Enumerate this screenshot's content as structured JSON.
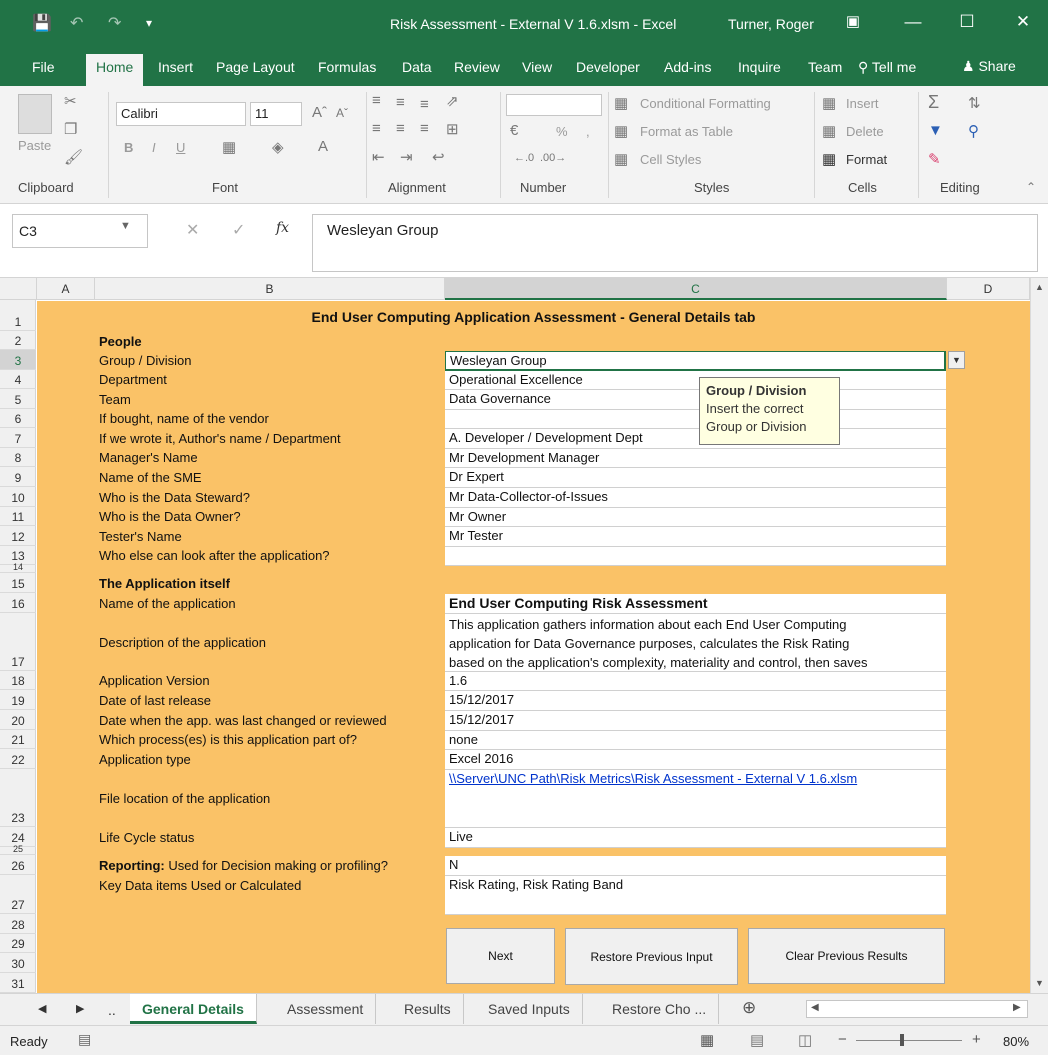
{
  "window": {
    "title": "Risk Assessment - External V 1.6.xlsm - Excel",
    "user": "Turner, Roger"
  },
  "ribbon_tabs": [
    "File",
    "Home",
    "Insert",
    "Page Layout",
    "Formulas",
    "Data",
    "Review",
    "View",
    "Developer",
    "Add-ins",
    "Inquire",
    "Team"
  ],
  "tell_me": "Tell me",
  "share": "Share",
  "ribbon": {
    "clipboard": {
      "label": "Clipboard",
      "paste": "Paste"
    },
    "font": {
      "label": "Font",
      "name": "Calibri",
      "size": "11",
      "bold": "B",
      "italic": "I",
      "underline": "U"
    },
    "alignment": {
      "label": "Alignment"
    },
    "number": {
      "label": "Number",
      "percent": "%",
      "comma": ","
    },
    "styles": {
      "label": "Styles",
      "conditional": "Conditional Formatting",
      "table": "Format as Table",
      "cell_styles": "Cell Styles"
    },
    "cells": {
      "label": "Cells",
      "insert": "Insert",
      "delete": "Delete",
      "format": "Format"
    },
    "editing": {
      "label": "Editing"
    }
  },
  "formula_bar": {
    "name_box": "C3",
    "fx": "fx",
    "content": "Wesleyan Group"
  },
  "columns": [
    "A",
    "B",
    "C",
    "D"
  ],
  "rows": [
    "1",
    "2",
    "3",
    "4",
    "5",
    "6",
    "7",
    "8",
    "9",
    "10",
    "11",
    "12",
    "13",
    "14",
    "15",
    "16",
    "17",
    "18",
    "19",
    "20",
    "21",
    "22",
    "23",
    "24",
    "25",
    "26",
    "27",
    "28",
    "29",
    "30",
    "31"
  ],
  "sheet": {
    "title": "End User Computing Application Assessment - General Details tab",
    "people_header": "People",
    "app_header": "The Application itself",
    "reporting_prefix": "Reporting:",
    "reporting_label": " Used for Decision making or profiling?",
    "reporting_value": "N",
    "key_data_label": "Key Data items Used or Calculated",
    "key_data_value": "Risk Rating, Risk Rating Band",
    "people": [
      {
        "label": "Group / Division",
        "value": "Wesleyan Group"
      },
      {
        "label": "Department",
        "value": "Operational Excellence"
      },
      {
        "label": "Team",
        "value": "Data Governance"
      },
      {
        "label": "If bought, name of the vendor",
        "value": ""
      },
      {
        "label": "If we wrote it, Author's name / Department",
        "value": "A. Developer / Development Dept"
      },
      {
        "label": "Manager's Name",
        "value": "Mr Development Manager"
      },
      {
        "label": "Name of the SME",
        "value": "Dr Expert"
      },
      {
        "label": "Who is the Data Steward?",
        "value": "Mr Data-Collector-of-Issues"
      },
      {
        "label": "Who is the Data Owner?",
        "value": "Mr Owner"
      },
      {
        "label": "Tester's Name",
        "value": "Mr Tester"
      },
      {
        "label": "Who else can look after the application?",
        "value": ""
      }
    ],
    "app": {
      "name_label": "Name of the application",
      "name_value": "End User Computing Risk Assessment",
      "desc_label": "Description of the application",
      "desc_lines": [
        "This application gathers information about each End User Computing",
        "application for Data Governance purposes, calculates the Risk Rating",
        "based on the application's complexity, materiality and control, then saves"
      ],
      "fields": [
        {
          "label": "Application Version",
          "value": "1.6"
        },
        {
          "label": "Date of last release",
          "value": "15/12/2017"
        },
        {
          "label": "Date when the app. was last changed or reviewed",
          "value": "15/12/2017"
        },
        {
          "label": "Which process(es) is this application part of?",
          "value": "none"
        },
        {
          "label": "Application type",
          "value": "Excel 2016"
        }
      ],
      "file_label": "File location of the application",
      "file_value": "\\\\Server\\UNC Path\\Risk Metrics\\Risk Assessment - External V 1.6.xlsm",
      "lifecycle_label": "Life Cycle status",
      "lifecycle_value": "Live"
    },
    "tooltip": {
      "title": "Group / Division",
      "line1": "Insert the correct",
      "line2": "Group or Division"
    },
    "buttons": {
      "next": "Next",
      "restore": "Restore Previous Input",
      "clear": "Clear Previous Results"
    }
  },
  "sheet_tabs": [
    "General Details",
    "Assessment",
    "Results",
    "Saved Inputs",
    "Restore Cho ..."
  ],
  "sheet_tabs_more": "..",
  "status": {
    "ready": "Ready",
    "zoom": "80%"
  },
  "colors": {
    "excel_green": "#217346",
    "sheet_bg": "#fac267",
    "tooltip_bg": "#ffffe1"
  }
}
